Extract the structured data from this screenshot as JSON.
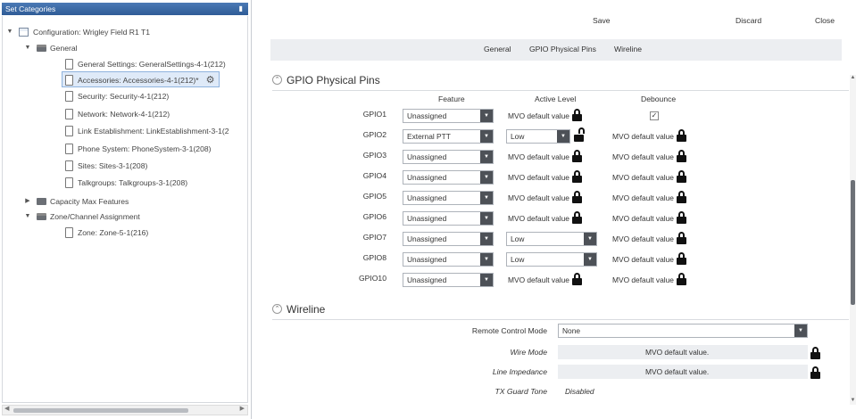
{
  "left_panel": {
    "title": "Set Categories",
    "pin_icon": "pin-icon",
    "tree": [
      {
        "label": "Configuration: Wrigley Field R1 T1",
        "icon": "config-icon",
        "level": 0,
        "expanded": true
      },
      {
        "label": "General",
        "icon": "folder-open-icon",
        "level": 1,
        "expanded": true
      },
      {
        "label": "General Settings: GeneralSettings-4-1(212)",
        "icon": "document-icon",
        "level": 2
      },
      {
        "label": "Accessories: Accessories-4-1(212)*",
        "icon": "document-icon",
        "level": 2,
        "selected": true
      },
      {
        "label": "Security: Security-4-1(212)",
        "icon": "document-icon",
        "level": 2
      },
      {
        "label": "Network: Network-4-1(212)",
        "icon": "document-icon",
        "level": 2
      },
      {
        "label": "Link Establishment: LinkEstablishment-3-1(2",
        "icon": "document-icon",
        "level": 2
      },
      {
        "label": "Phone System: PhoneSystem-3-1(208)",
        "icon": "document-icon",
        "level": 2
      },
      {
        "label": "Sites: Sites-3-1(208)",
        "icon": "document-icon",
        "level": 2
      },
      {
        "label": "Talkgroups: Talkgroups-3-1(208)",
        "icon": "document-icon",
        "level": 2
      },
      {
        "label": "Capacity Max Features",
        "icon": "folder-icon",
        "level": 1,
        "expanded": false
      },
      {
        "label": "Zone/Channel Assignment",
        "icon": "folder-open-icon",
        "level": 1,
        "expanded": true
      },
      {
        "label": "Zone: Zone-5-1(216)",
        "icon": "document-icon",
        "level": 2
      }
    ]
  },
  "toolbar": {
    "save": "Save",
    "discard": "Discard",
    "close": "Close"
  },
  "tabs": [
    "General",
    "GPIO Physical Pins",
    "Wireline"
  ],
  "gpio": {
    "title": "GPIO Physical Pins",
    "columns": {
      "feature": "Feature",
      "active_level": "Active Level",
      "debounce": "Debounce"
    },
    "rows": [
      {
        "pin": "GPIO1",
        "feature": "Unassigned",
        "active_level": {
          "type": "mvo",
          "text": "MVO default value",
          "lock": "locked"
        },
        "debounce": {
          "type": "checkbox",
          "checked": true
        }
      },
      {
        "pin": "GPIO2",
        "feature": "External PTT",
        "active_level": {
          "type": "select",
          "text": "Low",
          "lock": "unlocked"
        },
        "debounce": {
          "type": "mvo",
          "text": "MVO default value",
          "lock": "locked"
        }
      },
      {
        "pin": "GPIO3",
        "feature": "Unassigned",
        "active_level": {
          "type": "mvo",
          "text": "MVO default value",
          "lock": "locked"
        },
        "debounce": {
          "type": "mvo",
          "text": "MVO default value",
          "lock": "locked"
        }
      },
      {
        "pin": "GPIO4",
        "feature": "Unassigned",
        "active_level": {
          "type": "mvo",
          "text": "MVO default value",
          "lock": "locked"
        },
        "debounce": {
          "type": "mvo",
          "text": "MVO default value",
          "lock": "locked"
        }
      },
      {
        "pin": "GPIO5",
        "feature": "Unassigned",
        "active_level": {
          "type": "mvo",
          "text": "MVO default value",
          "lock": "locked"
        },
        "debounce": {
          "type": "mvo",
          "text": "MVO default value",
          "lock": "locked"
        }
      },
      {
        "pin": "GPIO6",
        "feature": "Unassigned",
        "active_level": {
          "type": "mvo",
          "text": "MVO default value",
          "lock": "locked"
        },
        "debounce": {
          "type": "mvo",
          "text": "MVO default value",
          "lock": "locked"
        }
      },
      {
        "pin": "GPIO7",
        "feature": "Unassigned",
        "active_level": {
          "type": "select",
          "text": "Low",
          "lock": "none"
        },
        "debounce": {
          "type": "mvo",
          "text": "MVO default value",
          "lock": "locked"
        }
      },
      {
        "pin": "GPIO8",
        "feature": "Unassigned",
        "active_level": {
          "type": "select",
          "text": "Low",
          "lock": "none"
        },
        "debounce": {
          "type": "mvo",
          "text": "MVO default value",
          "lock": "locked"
        }
      },
      {
        "pin": "GPIO10",
        "feature": "Unassigned",
        "active_level": {
          "type": "mvo",
          "text": "MVO default value",
          "lock": "locked"
        },
        "debounce": {
          "type": "mvo",
          "text": "MVO default value",
          "lock": "locked"
        }
      }
    ]
  },
  "wireline": {
    "title": "Wireline",
    "remote_control_mode": {
      "label": "Remote Control Mode",
      "value": "None"
    },
    "wire_mode": {
      "label": "Wire Mode",
      "value": "MVO default value."
    },
    "line_impedance": {
      "label": "Line Impedance",
      "value": "MVO default value."
    },
    "tx_guard_tone": {
      "label": "TX Guard Tone",
      "value": "Disabled"
    }
  },
  "colors": {
    "header_blue": "#2f5c96",
    "selection_bg": "#dfeaf8",
    "dropdown_dark": "#4d5157",
    "lock_black": "#111111"
  }
}
